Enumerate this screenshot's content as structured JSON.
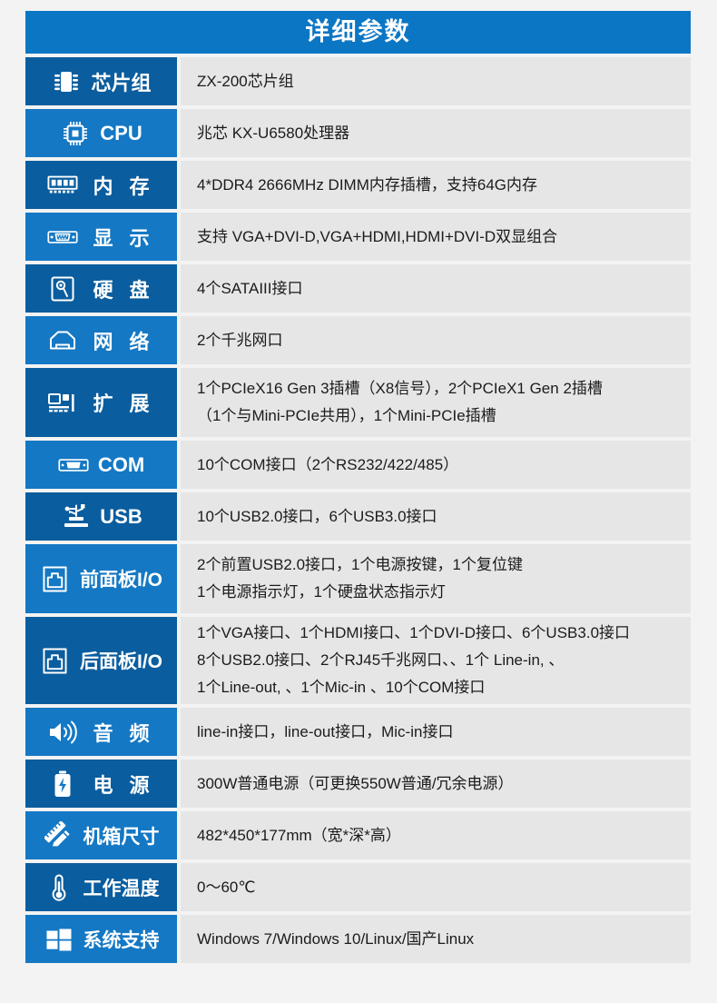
{
  "header": {
    "title": "详细参数"
  },
  "rows": [
    {
      "icon": "chipset-icon",
      "label": "芯片组",
      "lines": [
        "ZX-200芯片组"
      ]
    },
    {
      "icon": "cpu-icon",
      "label": "CPU",
      "lines": [
        "兆芯 KX-U6580处理器"
      ]
    },
    {
      "icon": "memory-icon",
      "label": "内 存",
      "lines": [
        "4*DDR4 2666MHz DIMM内存插槽，支持64G内存"
      ]
    },
    {
      "icon": "vga-port-icon",
      "label": "显 示",
      "lines": [
        "支持 VGA+DVI-D,VGA+HDMI,HDMI+DVI-D双显组合"
      ]
    },
    {
      "icon": "harddisk-icon",
      "label": "硬 盘",
      "lines": [
        "4个SATAIII接口"
      ]
    },
    {
      "icon": "network-rj45-icon",
      "label": "网 络",
      "lines": [
        "2个千兆网口"
      ]
    },
    {
      "icon": "expansion-card-icon",
      "label": "扩 展",
      "lines": [
        "1个PCIeX16 Gen 3插槽（X8信号），2个PCIeX1 Gen 2插槽",
        "（1个与Mini-PCIe共用），1个Mini-PCIe插槽"
      ]
    },
    {
      "icon": "com-port-icon",
      "label": "COM",
      "lines": [
        "10个COM接口（2个RS232/422/485）"
      ]
    },
    {
      "icon": "usb-icon",
      "label": "USB",
      "lines": [
        "10个USB2.0接口，6个USB3.0接口"
      ]
    },
    {
      "icon": "front-panel-icon",
      "label": "前面板I/O",
      "lines": [
        "2个前置USB2.0接口，1个电源按键，1个复位键",
        "1个电源指示灯，1个硬盘状态指示灯"
      ]
    },
    {
      "icon": "rear-panel-icon",
      "label": "后面板I/O",
      "lines": [
        "1个VGA接口、1个HDMI接口、1个DVI-D接口、6个USB3.0接口",
        "8个USB2.0接口、2个RJ45千兆网口、、1个 Line-in, 、",
        "1个Line-out, 、1个Mic-in 、10个COM接口"
      ]
    },
    {
      "icon": "speaker-icon",
      "label": "音 频",
      "lines": [
        "line-in接口，line-out接口，Mic-in接口"
      ]
    },
    {
      "icon": "battery-icon",
      "label": "电 源",
      "lines": [
        "300W普通电源（可更换550W普通/冗余电源）"
      ]
    },
    {
      "icon": "ruler-pencil-icon",
      "label": "机箱尺寸",
      "lines": [
        "482*450*177mm（宽*深*高）"
      ]
    },
    {
      "icon": "thermometer-icon",
      "label": "工作温度",
      "lines": [
        "0～60℃"
      ]
    },
    {
      "icon": "windows-icon",
      "label": "系统支持",
      "lines": [
        "Windows 7/Windows 10/Linux/国产Linux"
      ]
    }
  ],
  "colors": {
    "header_blue": "#0b76c4",
    "label_dark_blue": "#0a5d9e",
    "label_light_blue": "#1478c4",
    "value_bg": "#e6e6e6",
    "page_bg": "#f3f3f3",
    "text_dark": "#1b1b1b"
  }
}
